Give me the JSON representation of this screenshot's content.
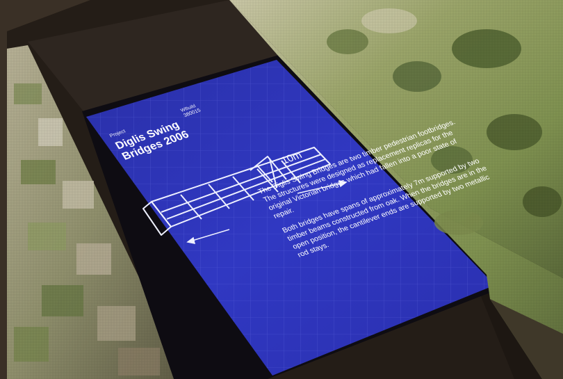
{
  "photo": {
    "subject": "Interactive map table with projected display panel",
    "colors": {
      "screen_blue": "#2f35b8",
      "blueprint_line": "#eef0ff",
      "aerial_green": "#8fa05d",
      "table_dark": "#1e1813"
    }
  },
  "screen": {
    "project_label": "Project",
    "project_title": "Diglis Swing Bridges 2006",
    "reference_label": "WBuild",
    "reference_value": "380015",
    "dimension_label": "10m",
    "description": [
      "The Diglis Swing Bridges are two timber pedestrian footbridges. The structures were designed as replacement replicas for the original Victorian bridges which had fallen into a poor state of repair.",
      "Both bridges have spans of approximately 7m supported by two timber beams constructed from oak. When the bridges are in the open position, the cantilever ends are supported by two metallic rod stays."
    ]
  }
}
